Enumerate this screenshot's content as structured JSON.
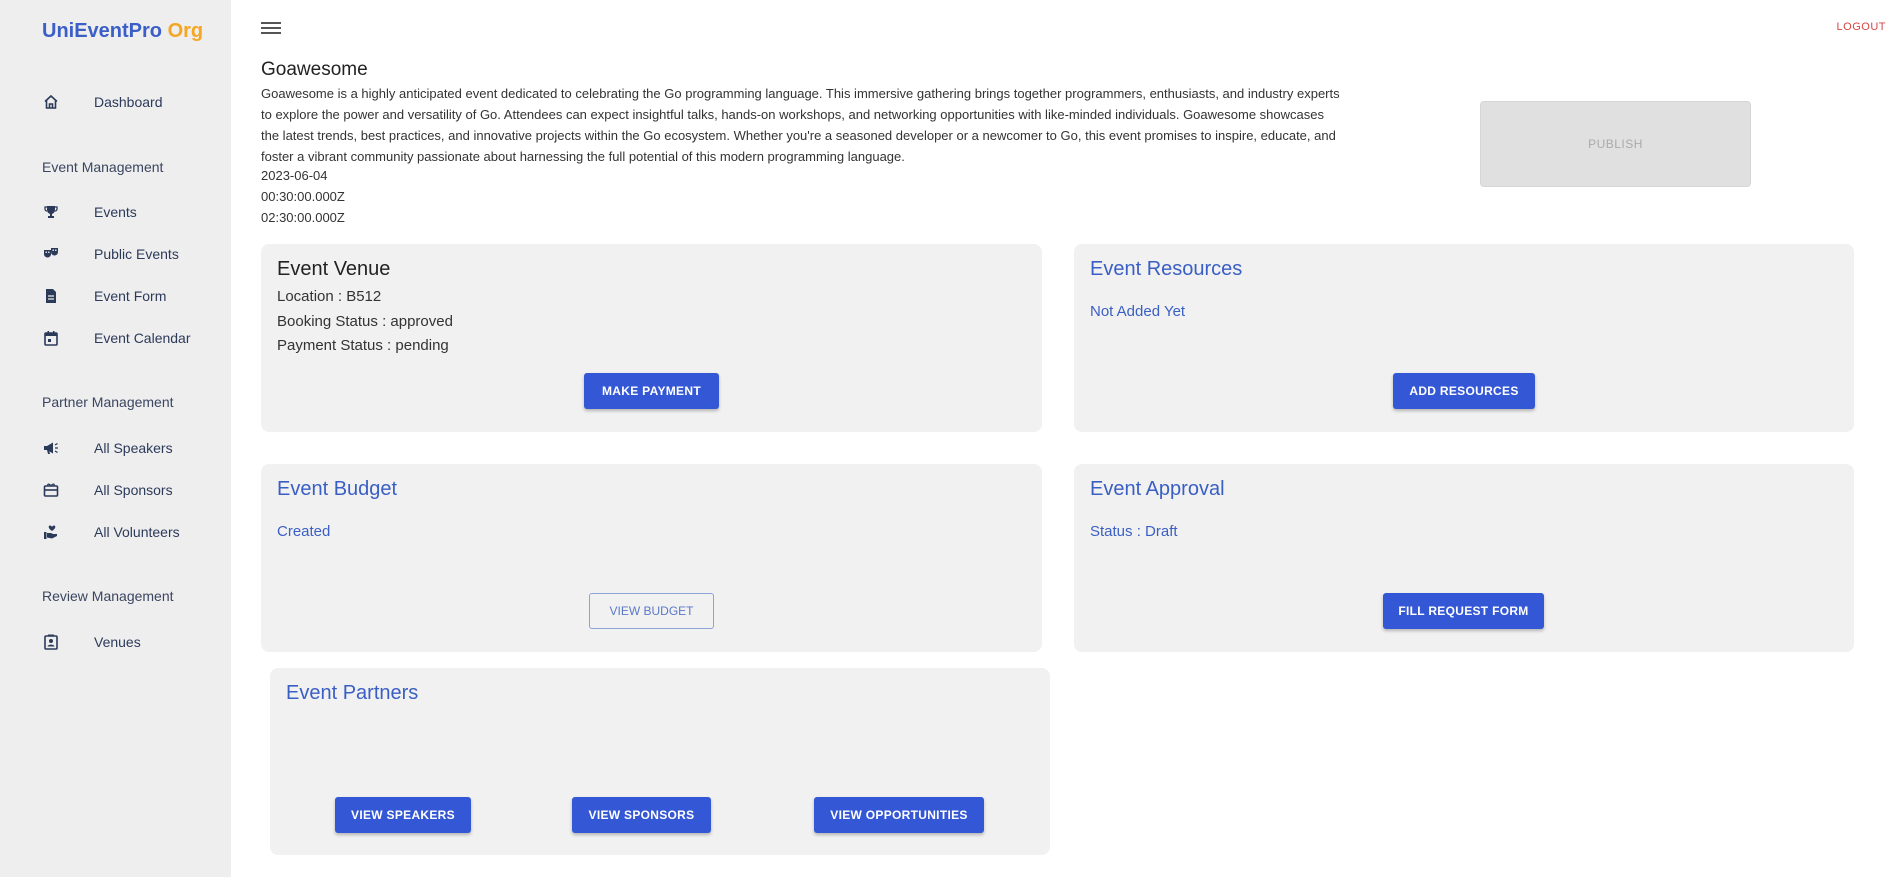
{
  "brand": {
    "name": "UniEventPro",
    "suffix": "Org"
  },
  "sidebar": {
    "dashboard": "Dashboard",
    "sections": [
      {
        "title": "Event Management",
        "items": [
          "Events",
          "Public Events",
          "Event Form",
          "Event Calendar"
        ]
      },
      {
        "title": "Partner Management",
        "items": [
          "All Speakers",
          "All Sponsors",
          "All Volunteers"
        ]
      },
      {
        "title": "Review Management",
        "items": [
          "Venues"
        ]
      }
    ]
  },
  "topbar": {
    "logout": "LOGOUT"
  },
  "event": {
    "title": "Goawesome",
    "description": "Goawesome is a highly anticipated event dedicated to celebrating the Go programming language. This immersive gathering brings together programmers, enthusiasts, and industry experts to explore the power and versatility of Go. Attendees can expect insightful talks, hands-on workshops, and networking opportunities with like-minded individuals. Goawesome showcases the latest trends, best practices, and innovative projects within the Go ecosystem. Whether you're a seasoned developer or a newcomer to Go, this event promises to inspire, educate, and foster a vibrant community passionate about harnessing the full potential of this modern programming language.",
    "date": "2023-06-04",
    "start_time": "00:30:00.000Z",
    "end_time": "02:30:00.000Z",
    "publish": "PUBLISH"
  },
  "venue": {
    "title": "Event Venue",
    "location": "Location : B512",
    "booking": "Booking Status : approved",
    "payment": "Payment Status : pending",
    "button": "MAKE PAYMENT"
  },
  "resources": {
    "title": "Event Resources",
    "status": "Not Added Yet",
    "button": "ADD RESOURCES"
  },
  "budget": {
    "title": "Event Budget",
    "status": "Created",
    "button": "VIEW BUDGET"
  },
  "approval": {
    "title": "Event Approval",
    "status": "Status : Draft",
    "button": "FILL REQUEST FORM"
  },
  "partners": {
    "title": "Event Partners",
    "speakers_button": "VIEW SPEAKERS",
    "sponsors_button": "VIEW SPONSORS",
    "opportunities_button": "VIEW OPPORTUNITIES"
  },
  "colors": {
    "primary": "#3457d5",
    "brand_blue": "#3b5fc7",
    "brand_orange": "#f5a623",
    "logout": "#d64545"
  }
}
